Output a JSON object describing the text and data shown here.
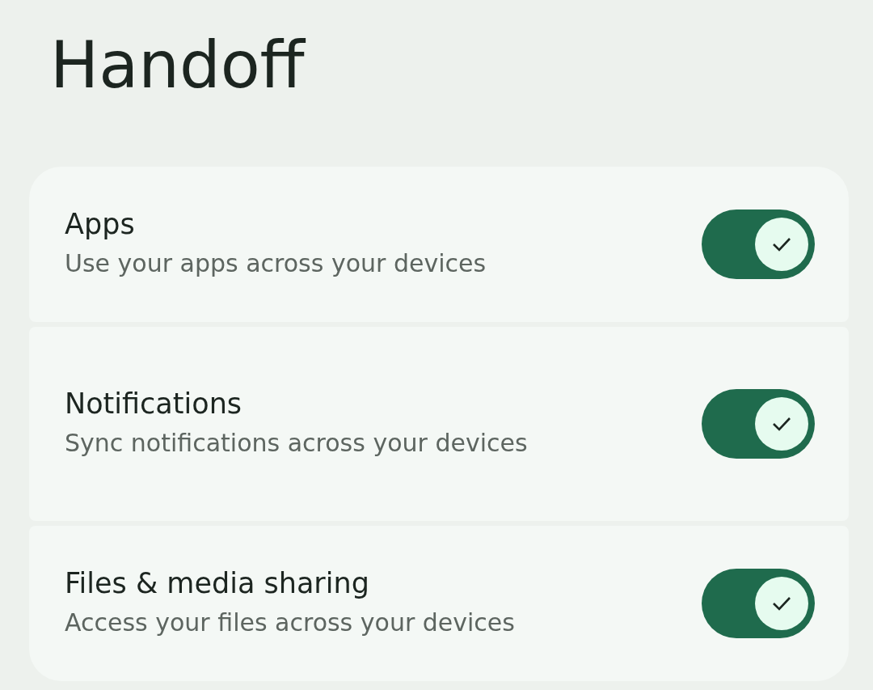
{
  "title": "Handoff",
  "settings": [
    {
      "title": "Apps",
      "subtitle": "Use your apps across your devices",
      "on": true
    },
    {
      "title": "Notifications",
      "subtitle": "Sync notifications across your devices",
      "on": true
    },
    {
      "title": "Files & media sharing",
      "subtitle": "Access your files across your devices",
      "on": true
    }
  ]
}
